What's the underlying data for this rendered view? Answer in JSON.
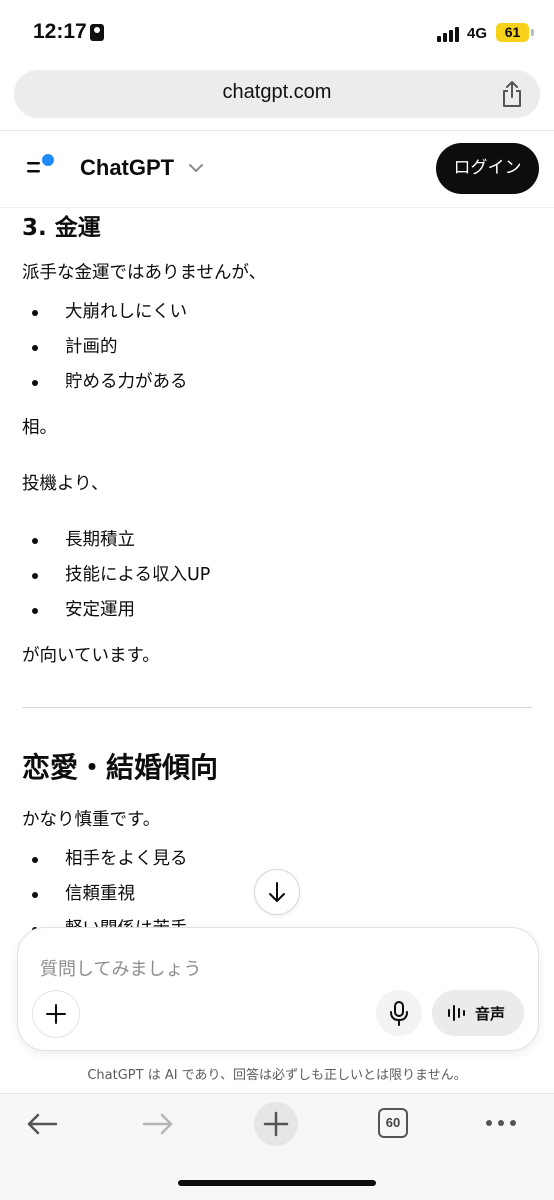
{
  "status": {
    "time": "12:17",
    "network": "4G",
    "battery": "61"
  },
  "browser": {
    "url": "chatgpt.com",
    "tab_count": "60"
  },
  "header": {
    "brand": "ChatGPT",
    "login_label": "ログイン"
  },
  "content": {
    "section3_title": "3. 金運",
    "intro": "派手な金運ではありませんが、",
    "list1": [
      "大崩れしにくい",
      "計画的",
      "貯める力がある"
    ],
    "after_list1": "相。",
    "invest_intro": "投機より、",
    "list2": [
      "長期積立",
      "技能による収入UP",
      "安定運用"
    ],
    "after_list2": "が向いています。",
    "love_title": "恋愛・結婚傾向",
    "love_intro": "かなり慎重です。",
    "list3": [
      "相手をよく見る",
      "信頼重視",
      "軽い関係は苦手"
    ]
  },
  "composer": {
    "placeholder": "質問してみましょう",
    "voice_label": "音声"
  },
  "disclaimer": "ChatGPT は AI であり、回答は必ずしも正しいとは限りません。",
  "colors": {
    "accent_dot": "#1d8cf8",
    "battery": "#f6d21a",
    "login_bg": "#0d0d0d"
  }
}
